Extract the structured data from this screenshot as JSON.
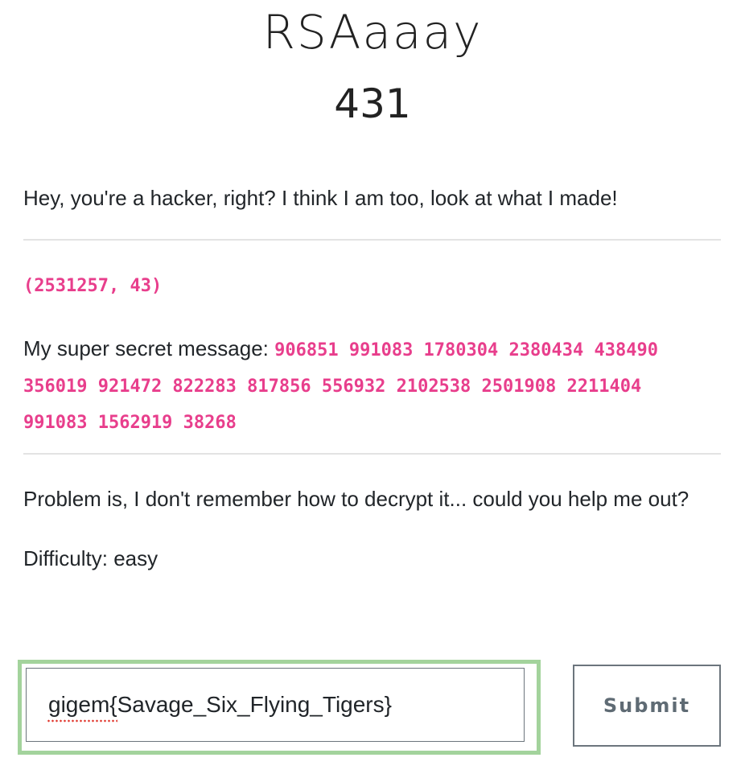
{
  "challenge": {
    "name": "RSAaaay",
    "points": "431",
    "intro": "Hey, you're a hacker, right? I think I am too, look at what I made!",
    "public_key": "(2531257, 43)",
    "message_label": "My super secret message:",
    "message_line1": "906851 991083 1780304 2380434 438490",
    "message_line2": "356019 921472 822283 817856 556932 2102538 2501908 2211404",
    "message_line3": "991083 1562919 38268",
    "problem": "Problem is, I don't remember how to decrypt it... could you help me out?",
    "difficulty": "Difficulty: easy"
  },
  "submission": {
    "flag_value": "gigem{Savage_Six_Flying_Tigers}",
    "submit_label": "Submit"
  },
  "colors": {
    "code_pink": "#e83e8c",
    "focus_green": "#a3d39c",
    "button_gray": "#6c757d"
  }
}
